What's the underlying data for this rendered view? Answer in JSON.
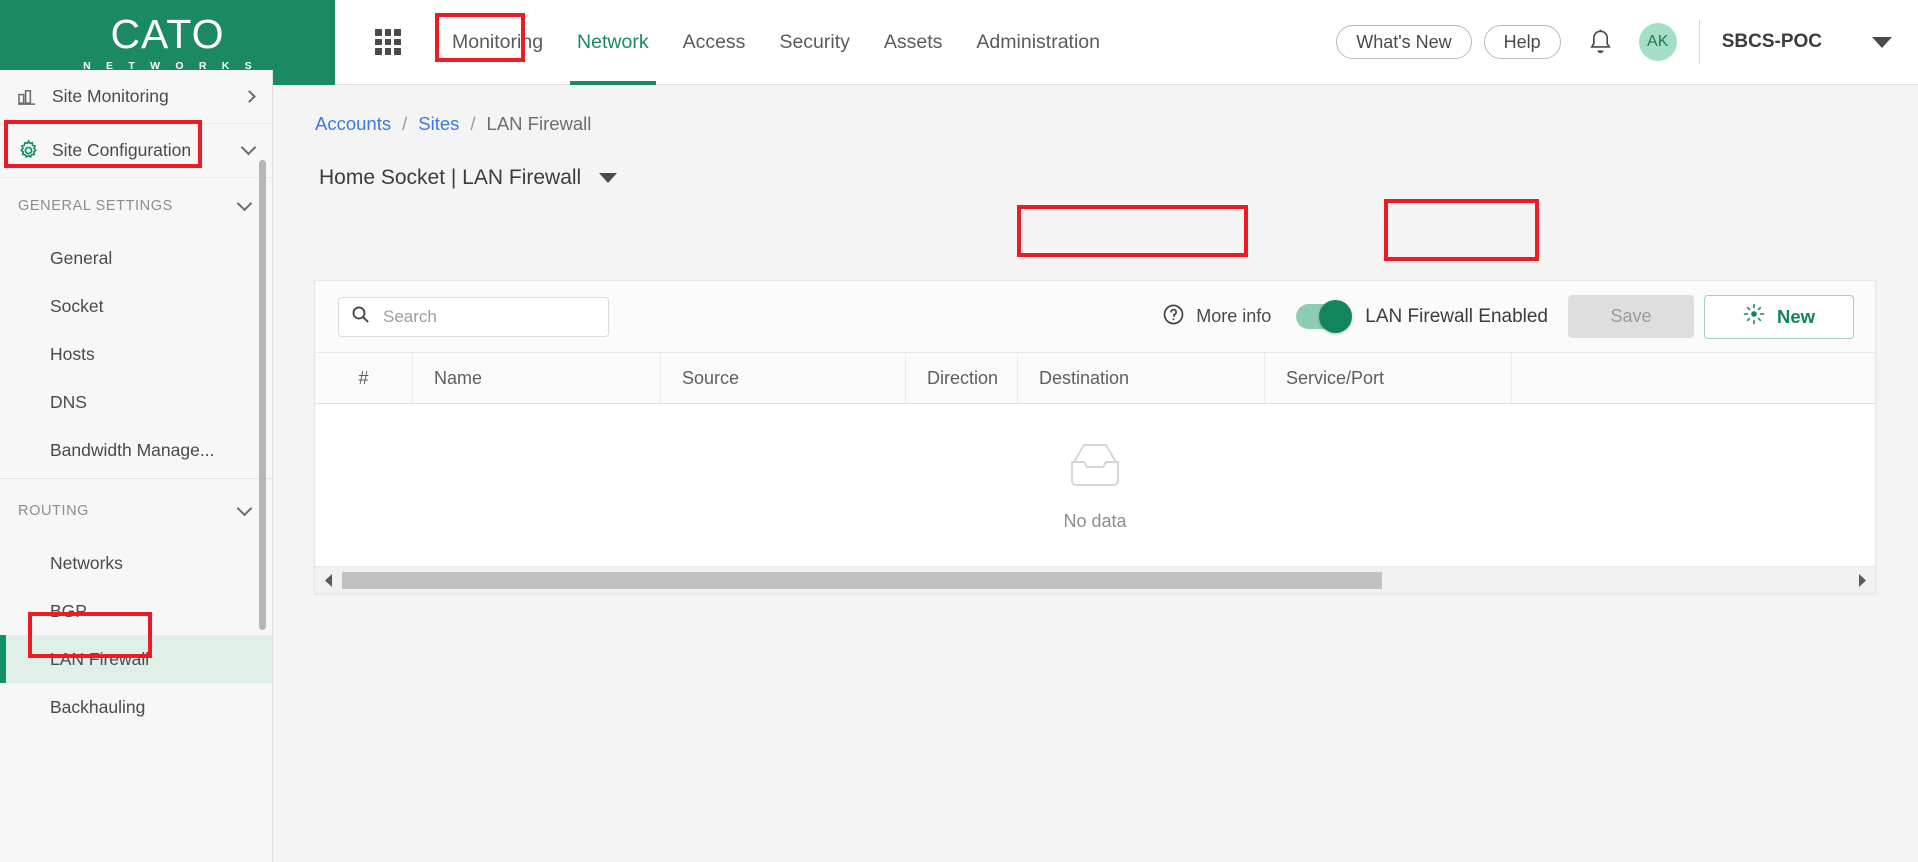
{
  "brand": {
    "name": "CATO",
    "tagline": "N E T W O R K S",
    "green": "#1b8a62"
  },
  "topnav": {
    "apps_icon": "grid-apps-icon",
    "items": [
      {
        "label": "Monitoring",
        "active": false
      },
      {
        "label": "Network",
        "active": true
      },
      {
        "label": "Access",
        "active": false
      },
      {
        "label": "Security",
        "active": false
      },
      {
        "label": "Assets",
        "active": false
      },
      {
        "label": "Administration",
        "active": false
      }
    ],
    "whats_new": "What's New",
    "help": "Help",
    "notifications_icon": "bell-icon",
    "avatar_initials": "AK",
    "account": "SBCS-POC",
    "account_caret": "chevron-down-icon"
  },
  "sidebar": {
    "site_monitoring": {
      "label": "Site Monitoring",
      "icon": "bar-chart-icon",
      "chevron": "chevron-right-icon"
    },
    "site_configuration": {
      "label": "Site Configuration",
      "icon": "gear-icon",
      "chevron": "chevron-down-icon"
    },
    "groups": [
      {
        "label": "GENERAL SETTINGS",
        "chevron": "chevron-down-icon",
        "items": [
          {
            "label": "General",
            "selected": false
          },
          {
            "label": "Socket",
            "selected": false
          },
          {
            "label": "Hosts",
            "selected": false
          },
          {
            "label": "DNS",
            "selected": false
          },
          {
            "label": "Bandwidth Manage...",
            "selected": false
          }
        ]
      },
      {
        "label": "ROUTING",
        "chevron": "chevron-down-icon",
        "items": [
          {
            "label": "Networks",
            "selected": false
          },
          {
            "label": "BGP",
            "selected": false
          },
          {
            "label": "LAN Firewall",
            "selected": true
          },
          {
            "label": "Backhauling",
            "selected": false
          }
        ]
      }
    ]
  },
  "main": {
    "breadcrumb": [
      {
        "label": "Accounts",
        "link": true
      },
      {
        "label": "Sites",
        "link": true
      },
      {
        "label": "LAN Firewall",
        "link": false
      }
    ],
    "breadcrumb_separator": "/",
    "page_title": "Home Socket | LAN Firewall",
    "title_caret": "caret-down-icon",
    "toolbar": {
      "search_placeholder": "Search",
      "search_value": "",
      "search_icon": "search-icon",
      "more_info": "More info",
      "more_info_icon": "question-circle-icon",
      "toggle_label": "LAN Firewall Enabled",
      "toggle_on": true,
      "save_label": "Save",
      "save_disabled": true,
      "new_label": "New",
      "new_icon": "sparkle-new-icon"
    },
    "table": {
      "columns": [
        "#",
        "Name",
        "Source",
        "Direction",
        "Destination",
        "Service/Port"
      ],
      "rows": [],
      "empty_label": "No data",
      "empty_icon": "empty-inbox-icon",
      "hscroll": {
        "left_arrow": "chevron-left-icon",
        "right_arrow": "chevron-right-icon"
      }
    }
  },
  "annotations": {
    "color": "#ed1c24",
    "boxes": [
      {
        "name": "annotation-network-tab"
      },
      {
        "name": "annotation-site-configuration"
      },
      {
        "name": "annotation-lan-firewall-nav"
      },
      {
        "name": "annotation-lan-firewall-toggle"
      },
      {
        "name": "annotation-new-button"
      }
    ]
  }
}
